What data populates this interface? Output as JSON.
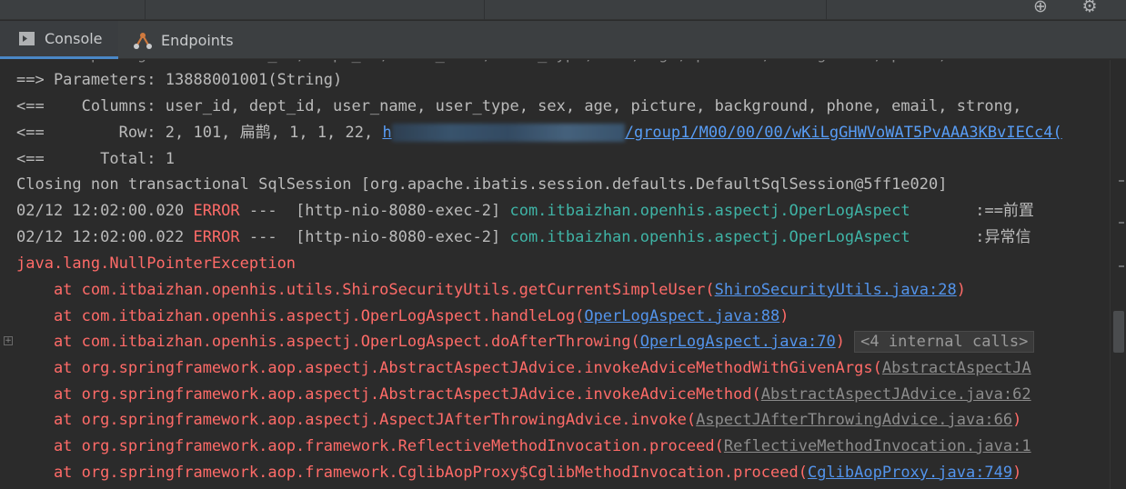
{
  "toolbar": {
    "icons": [
      "globe-icon",
      "gear-icon"
    ]
  },
  "tabs": [
    {
      "label": "Console",
      "icon": "console-icon",
      "active": true
    },
    {
      "label": "Endpoints",
      "icon": "endpoints-icon",
      "active": false
    }
  ],
  "console": {
    "lines": {
      "params_prefix": "==> Parameters: ",
      "params_value": "13888001001(String)",
      "columns_prefix": "<==    Columns: ",
      "columns_value": "user_id, dept_id, user_name, user_type, sex, age, picture, background, phone, email, strong,",
      "row_prefix": "<==        Row: ",
      "row_value": "2, 101, 扁鹊, 1, 1, 22, ",
      "row_link_start": "h",
      "row_link_end": "/group1/M00/00/00/wKiLgGHWVoWAT5PvAAA3KBvIECc4(",
      "total": "<==      Total: 1",
      "closing": "Closing non transactional SqlSession [org.apache.ibatis.session.defaults.DefaultSqlSession@5ff1e020]",
      "log1_time": "02/12 12:02:00.020 ",
      "log1_level": "ERROR",
      "log1_thread": " ---  [http-nio-8080-exec-2] ",
      "log1_class": "com.itbaizhan.openhis.aspectj.OperLogAspect",
      "log1_msg": "       :==前置",
      "log2_time": "02/12 12:02:00.022 ",
      "log2_level": "ERROR",
      "log2_thread": " ---  [http-nio-8080-exec-2] ",
      "log2_class": "com.itbaizhan.openhis.aspectj.OperLogAspect",
      "log2_msg": "       :异常信",
      "exception": "java.lang.NullPointerException",
      "internal_calls": "<4 internal calls>"
    },
    "stack": [
      {
        "text": "    at com.itbaizhan.openhis.utils.ShiroSecurityUtils.getCurrentSimpleUser(",
        "link": "ShiroSecurityUtils.java:28",
        "tail": ")",
        "grey": false
      },
      {
        "text": "    at com.itbaizhan.openhis.aspectj.OperLogAspect.handleLog(",
        "link": "OperLogAspect.java:88",
        "tail": ")",
        "grey": false
      },
      {
        "text": "    at com.itbaizhan.openhis.aspectj.OperLogAspect.doAfterThrowing(",
        "link": "OperLogAspect.java:70",
        "tail": ") ",
        "grey": false
      },
      {
        "text": "    at org.springframework.aop.aspectj.AbstractAspectJAdvice.invokeAdviceMethodWithGivenArgs(",
        "link": "AbstractAspectJA",
        "tail": "",
        "grey": true
      },
      {
        "text": "    at org.springframework.aop.aspectj.AbstractAspectJAdvice.invokeAdviceMethod(",
        "link": "AbstractAspectJAdvice.java:62",
        "tail": "",
        "grey": true
      },
      {
        "text": "    at org.springframework.aop.aspectj.AspectJAfterThrowingAdvice.invoke(",
        "link": "AspectJAfterThrowingAdvice.java:66",
        "tail": ")",
        "grey": true
      },
      {
        "text": "    at org.springframework.aop.framework.ReflectiveMethodInvocation.proceed(",
        "link": "ReflectiveMethodInvocation.java:1",
        "tail": "",
        "grey": true
      },
      {
        "text": "    at org.springframework.aop.framework.CglibAopProxy$CglibMethodInvocation.proceed(",
        "link": "CglibAopProxy.java:749",
        "tail": ")",
        "grey": false
      }
    ]
  },
  "colors": {
    "background": "#2b2b2b",
    "error": "#ff6b68",
    "class": "#3fb4a6",
    "link": "#589df6"
  }
}
